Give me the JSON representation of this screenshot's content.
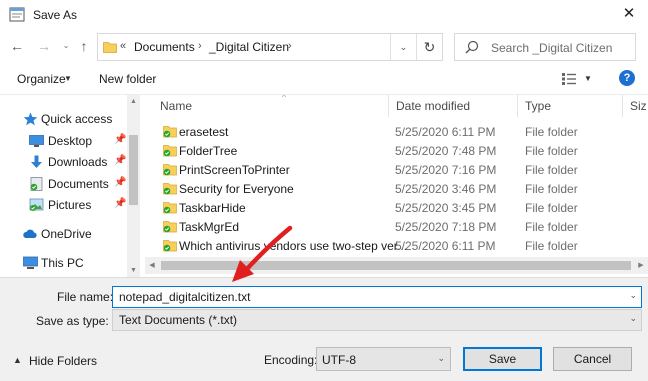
{
  "window": {
    "title": "Save As",
    "close_glyph": "✕"
  },
  "nav": {
    "back_glyph": "←",
    "forward_glyph": "→",
    "dropdown_glyph": "⌄",
    "up_glyph": "↑",
    "address": {
      "overflow_glyph": "«",
      "crumbs": [
        "Documents",
        "_Digital Citizen"
      ],
      "separator": "›",
      "dropdown_glyph": "⌄",
      "refresh_glyph": "↻"
    },
    "search": {
      "placeholder": "Search _Digital Citizen"
    }
  },
  "toolbar": {
    "organize": "Organize",
    "new_folder": "New folder",
    "help": "?"
  },
  "sidebar": {
    "items": [
      {
        "label": "Quick access",
        "icon": "star-icon",
        "pinned": false
      },
      {
        "label": "Desktop",
        "icon": "desktop-icon",
        "pinned": true
      },
      {
        "label": "Downloads",
        "icon": "download-icon",
        "pinned": true
      },
      {
        "label": "Documents",
        "icon": "documents-icon",
        "pinned": true
      },
      {
        "label": "Pictures",
        "icon": "pictures-icon",
        "pinned": true
      },
      {
        "label": "OneDrive",
        "icon": "cloud-icon",
        "pinned": false
      },
      {
        "label": "This PC",
        "icon": "computer-icon",
        "pinned": false
      }
    ]
  },
  "files": {
    "columns": [
      "Name",
      "Date modified",
      "Type",
      "Siz"
    ],
    "rows": [
      {
        "name": "erasetest",
        "date": "5/25/2020 6:11 PM",
        "type": "File folder"
      },
      {
        "name": "FolderTree",
        "date": "5/25/2020 7:48 PM",
        "type": "File folder"
      },
      {
        "name": "PrintScreenToPrinter",
        "date": "5/25/2020 7:16 PM",
        "type": "File folder"
      },
      {
        "name": "Security for Everyone",
        "date": "5/25/2020 3:46 PM",
        "type": "File folder"
      },
      {
        "name": "TaskbarHide",
        "date": "5/25/2020 3:45 PM",
        "type": "File folder"
      },
      {
        "name": "TaskMgrEd",
        "date": "5/25/2020 7:18 PM",
        "type": "File folder"
      },
      {
        "name": "Which antivirus vendors use two-step ver...",
        "date": "5/25/2020 6:11 PM",
        "type": "File folder"
      }
    ]
  },
  "form": {
    "file_name_label": "File name:",
    "file_name_value": "notepad_digitalcitizen.txt",
    "save_as_type_label": "Save as type:",
    "save_as_type_value": "Text Documents (*.txt)",
    "hide_folders": "Hide Folders",
    "encoding_label": "Encoding:",
    "encoding_value": "UTF-8",
    "save": "Save",
    "cancel": "Cancel"
  },
  "colors": {
    "accent": "#0078d7",
    "annotation_arrow": "#e02020",
    "folder": "#f7cf5a",
    "sync_check": "#2aa52a"
  }
}
